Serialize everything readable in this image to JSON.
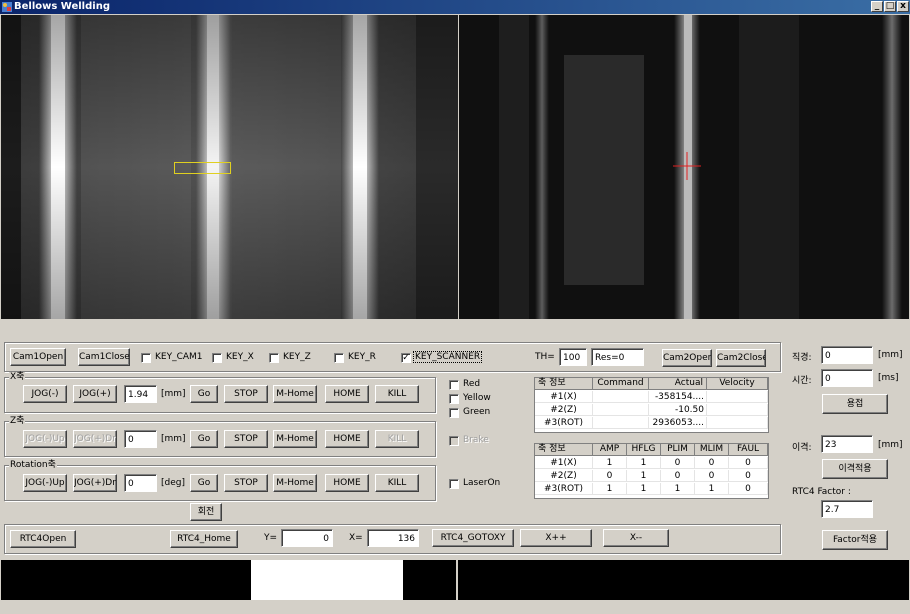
{
  "window": {
    "title": "Bellows Wellding",
    "min": "_",
    "max": "□",
    "close": "x"
  },
  "cam": {
    "open1": "Cam1Open",
    "close1": "Cam1Close",
    "open2": "Cam2Open",
    "close2": "Cam2Close",
    "key_cam1": "KEY_CAM1",
    "key_x": "KEY_X",
    "key_z": "KEY_Z",
    "key_r": "KEY_R",
    "key_scanner": "KEY_SCANNER",
    "key_scanner_mark": "✓",
    "th_label": "TH=",
    "th_value": "100",
    "res_value": "Res=0"
  },
  "x_axis": {
    "title": "X축",
    "jog_minus": "JOG(-)",
    "jog_plus": "JOG(+)",
    "value": "1.94",
    "unit": "[mm]",
    "go": "Go",
    "stop": "STOP",
    "mhome": "M-Home",
    "home": "HOME",
    "kill": "KILL"
  },
  "z_axis": {
    "title": "Z축",
    "jog_minus": "JOG(-)Up",
    "jog_plus": "JOG(+)Dn",
    "value": "0",
    "unit": "[mm]",
    "go": "Go",
    "stop": "STOP",
    "mhome": "M-Home",
    "home": "HOME",
    "kill": "KILL"
  },
  "rot_axis": {
    "title": "Rotation축",
    "jog_minus": "JOG(-)Up",
    "jog_plus": "JOG(+)Dn",
    "value": "0",
    "unit": "[deg]",
    "go": "Go",
    "stop": "STOP",
    "mhome": "M-Home",
    "home": "HOME",
    "kill": "KILL",
    "rotate": "회전"
  },
  "lights": {
    "red": "Red",
    "yellow": "Yellow",
    "green": "Green",
    "brake": "Brake",
    "laser": "LaserOn"
  },
  "grid1": {
    "headers": [
      "축 정보",
      "Command",
      "Actual",
      "Velocity"
    ],
    "rows": [
      [
        "#1(X)",
        "",
        "-358154....",
        ""
      ],
      [
        "#2(Z)",
        "",
        "-10.50",
        ""
      ],
      [
        "#3(ROT)",
        "",
        "2936053....",
        ""
      ]
    ]
  },
  "grid2": {
    "headers": [
      "축 정보",
      "AMP",
      "HFLG",
      "PLIM",
      "MLIM",
      "FAUL"
    ],
    "rows": [
      [
        "#1(X)",
        "1",
        "1",
        "0",
        "0",
        "0"
      ],
      [
        "#2(Z)",
        "0",
        "1",
        "0",
        "0",
        "0"
      ],
      [
        "#3(ROT)",
        "1",
        "1",
        "1",
        "1",
        "0"
      ]
    ]
  },
  "weld": {
    "diameter_label": "직경:",
    "diameter_value": "0",
    "diameter_unit": "[mm]",
    "time_label": "시간:",
    "time_value": "0",
    "time_unit": "[ms]",
    "weld_button": "용접",
    "gap_label": "이격:",
    "gap_value": "23",
    "gap_unit": "[mm]",
    "gap_apply": "이격적용",
    "factor_label": "RTC4 Factor :",
    "factor_value": "2.7",
    "factor_apply": "Factor적용"
  },
  "rtc": {
    "open": "RTC4Open",
    "home": "RTC4_Home",
    "y_label": "Y=",
    "y_value": "0",
    "x_label": "X=",
    "x_value": "136",
    "gotoxy": "RTC4_GOTOXY",
    "xpp": "X++",
    "xmm": "X--"
  }
}
